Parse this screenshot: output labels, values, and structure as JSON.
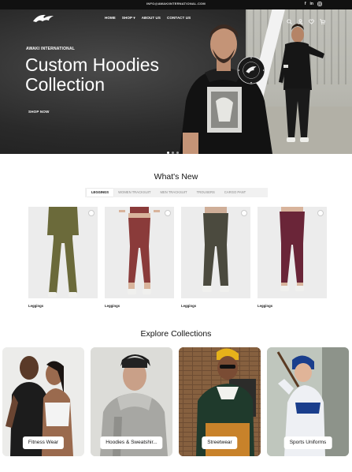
{
  "topbar": {
    "email": "INFO@AWAKIINTERNATIONAL.COM",
    "social": [
      "f",
      "in",
      "ig"
    ]
  },
  "nav": {
    "menu": [
      "HOME",
      "SHOP ▾",
      "ABOUT US",
      "CONTACT US"
    ],
    "icons": [
      "search-icon",
      "user-icon",
      "heart-icon",
      "cart-icon"
    ]
  },
  "hero": {
    "kicker": "AWAKI INTERNATIONAL",
    "headline_line1": "Custom Hoodies",
    "headline_line2": "Collection",
    "cta": "SHOP NOW",
    "badge_text": "• AWAKI INTERNATIONAL • PREMIUM •",
    "slides": 3,
    "active_slide": 1
  },
  "whats_new": {
    "title": "What's New",
    "tabs": [
      "LEGGINGS",
      "WOMEN TRACKSUIT",
      "MEN TRACKSUIT",
      "TROUSERS",
      "CARGO PANT"
    ],
    "active_tab": 0,
    "products": [
      {
        "name": "Leggings",
        "color": "#6b6a3a"
      },
      {
        "name": "Leggings",
        "color": "#8a3b3a"
      },
      {
        "name": "Leggings",
        "color": "#4b4a3e"
      },
      {
        "name": "Leggings",
        "color": "#6a2538"
      }
    ]
  },
  "collections": {
    "title": "Explore Collections",
    "items": [
      {
        "label": "Fitness Wear"
      },
      {
        "label": "Hoodies & Sweatshir..."
      },
      {
        "label": "Streetwear"
      },
      {
        "label": "Sports Uniforms"
      }
    ]
  }
}
